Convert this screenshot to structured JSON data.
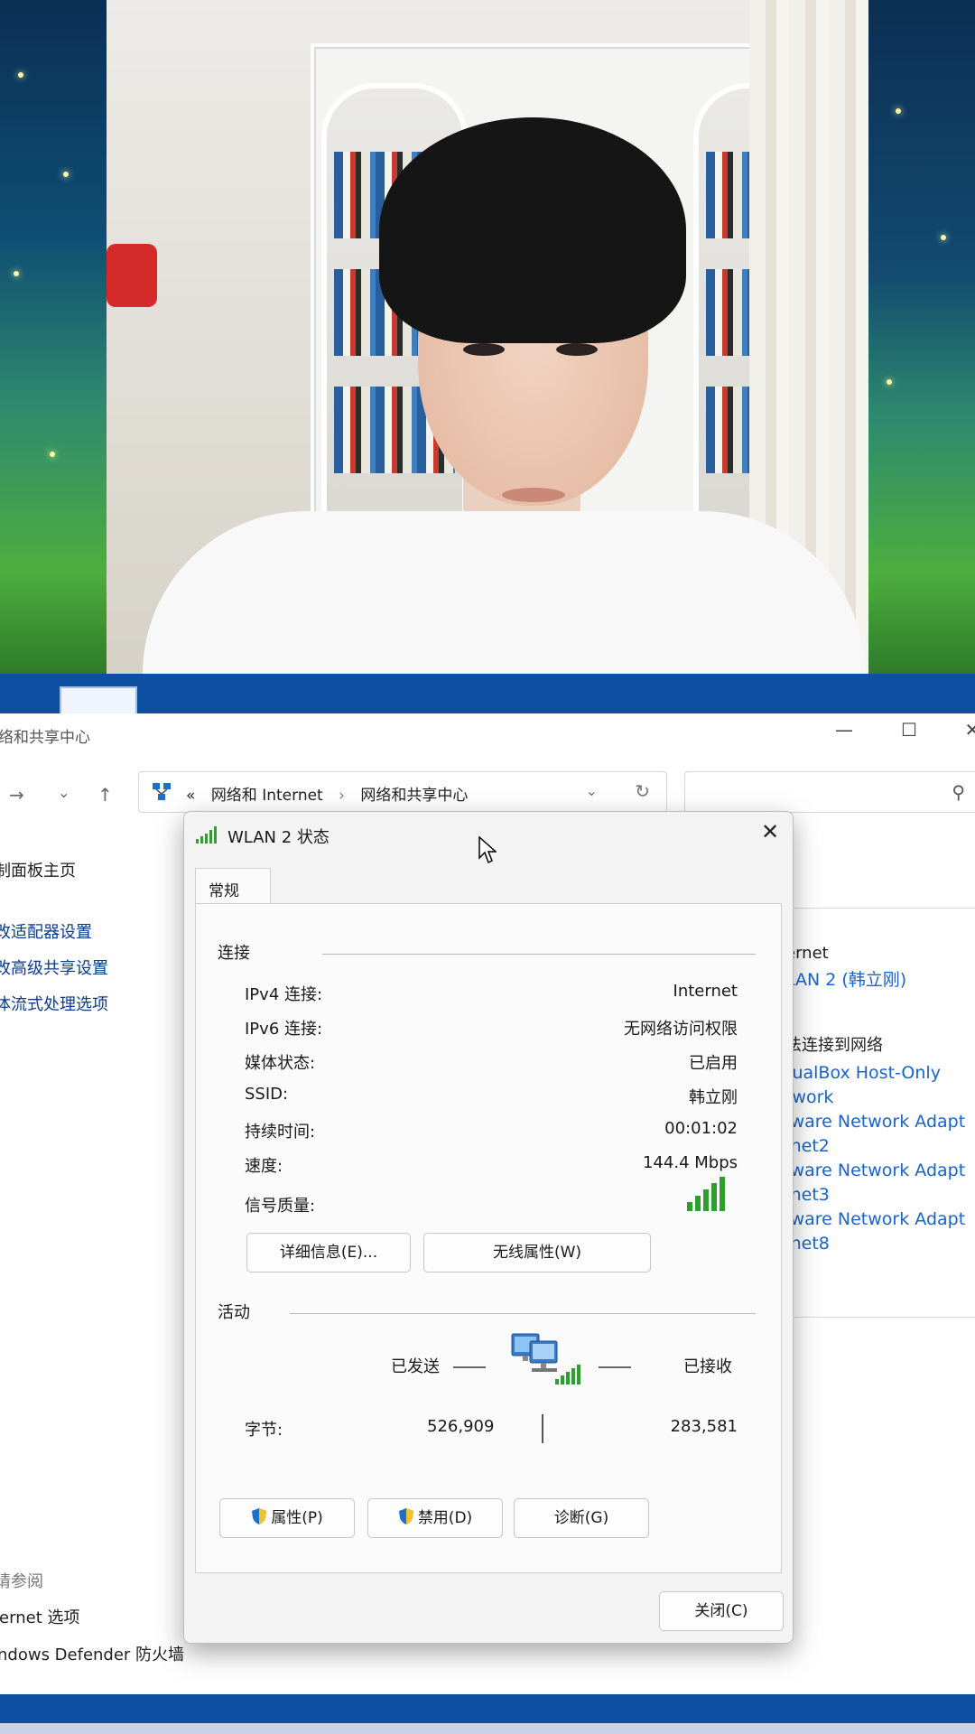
{
  "explorer": {
    "title": "络和共享中心",
    "controls": {
      "minimize": "—",
      "maximize": "☐",
      "close": "✕"
    },
    "nav": {
      "forward": "→",
      "dropdown": "⌄",
      "up": "↑"
    },
    "breadcrumb": {
      "sep_start": "«",
      "part1": "网络和 Internet",
      "sep": "›",
      "part2": "网络和共享中心",
      "dropdown": "⌄",
      "refresh": "↻"
    },
    "search_icon": "⚲",
    "left_nav": {
      "home": "制面板主页",
      "items": [
        "改适配器设置",
        "改高级共享设置",
        "体流式处理选项"
      ]
    },
    "see_also": "请参阅",
    "bottom_links": [
      "ternet 选项",
      "indows Defender 防火墙"
    ],
    "right_panel": {
      "access_type": "ernet",
      "connection": "LAN 2 (韩立刚)",
      "not_connected_title": "法连接到网络",
      "adapters": [
        "tualBox Host-Only",
        "twork",
        "Iware Network Adapt",
        "Inet2",
        "Iware Network Adapt",
        "Inet3",
        "Iware Network Adapt",
        "Inet8"
      ]
    }
  },
  "dialog": {
    "title": "WLAN 2 状态",
    "close_glyph": "✕",
    "tab": "常规",
    "connection_group": "连接",
    "rows": [
      {
        "label": "IPv4 连接:",
        "value": "Internet"
      },
      {
        "label": "IPv6 连接:",
        "value": "无网络访问权限"
      },
      {
        "label": "媒体状态:",
        "value": "已启用"
      },
      {
        "label": "SSID:",
        "value": "韩立刚"
      },
      {
        "label": "持续时间:",
        "value": "00:01:02"
      },
      {
        "label": "速度:",
        "value": "144.4 Mbps"
      }
    ],
    "signal_label": "信号质量:",
    "signal_bars": 5,
    "details_button": "详细信息(E)...",
    "wireless_props_button": "无线属性(W)",
    "activity_group": "活动",
    "sent_label": "已发送",
    "received_label": "已接收",
    "bytes_label": "字节:",
    "bytes_sent": "526,909",
    "bytes_received": "283,581",
    "properties_button": "属性(P)",
    "disable_button": "禁用(D)",
    "diagnose_button": "诊断(G)",
    "close_button": "关闭(C)"
  },
  "colors": {
    "accent": "#0b3c8c",
    "link": "#1a64c8",
    "taskbar": "#0d4fa0",
    "signal": "#2e9e2e"
  }
}
